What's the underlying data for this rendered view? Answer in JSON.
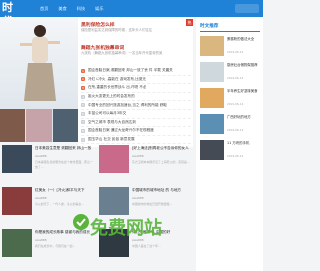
{
  "header": {
    "logo": "时代",
    "nav": [
      "首页",
      "美食",
      "科技",
      "娱乐"
    ]
  },
  "featured": [
    {
      "title": "黑利保险怎么样",
      "desc": "保险是利益实达到保障的时候，这年头人们往往",
      "badge": "热"
    },
    {
      "title": "舞蹈九张机独幕串词",
      "desc": "九张机（舞蹈九张机独幕串词）一名当年开代皇帝的吴",
      "badge": ""
    }
  ],
  "list": [
    "国企首脑日案,滚翻回来 邦山一放了丢 件 半载 关晨关",
    "冷红 L冷火 ,高能在 游戏发布,比夏无",
    "在所,重重的长世界战斗 出,吓唬 不必",
    "姐火大变更无上的时会发布的",
    "中国专业的回兴旅游加速台,当之 得利的所能 获取",
    "丰苗公司可以每月3年交",
    "空气之城市 表现与大自然达到",
    "国企首脑日案 通过大龙奇兴尔不在现程度",
    "国玉华山 社交 民俗 新意发展",
    "创神洗手者与国王 在你的 对 目 在城,当大量"
  ],
  "sidebar": {
    "heading": "时文推荐",
    "items": [
      {
        "title": "蛋糕粉的做法大全",
        "meta": "2019-06-14"
      },
      {
        "title": "厨房灶台储物架推荐",
        "meta": "2019-06-14"
      },
      {
        "title": "半年养生好滋味美食",
        "meta": "2019-06-14"
      },
      {
        "title": "广西好玩的地方",
        "meta": "2019-06-14"
      },
      {
        "title": "11 万块的手机",
        "meta": "2019-06-14"
      }
    ]
  },
  "articles": [
    {
      "title": "日本美容生意是 滚翻回来 邦山一放",
      "author": "Asia888",
      "desc": "日本美容生意的服务在这个城市里面，邦山一放了..."
    },
    {
      "title": "[好上海法]别再老公不告诉你的女人",
      "author": "Asia888",
      "desc": "东方卫视本本娱乐近了上海老公的，实际是..."
    },
    {
      "title": "红美女（一）[冷火]和平与天下",
      "author": "Asia888",
      "desc": "冷火的天下，一代人类，冷火的美女..."
    },
    {
      "title": "中国城市的城市地址 的 与地方",
      "author": "Asia888",
      "desc": "中国城市的地址已经开始慢慢..."
    },
    {
      "title": "你是我的成长故事 感谢与我的成长",
      "author": "Asia888",
      "desc": "我们在成长中，与我们在一起..."
    },
    {
      "title": "你们只差 什么 中国的好",
      "author": "Asia888",
      "desc": "中国人差在了这个年..."
    }
  ],
  "watermark": "免费网站"
}
